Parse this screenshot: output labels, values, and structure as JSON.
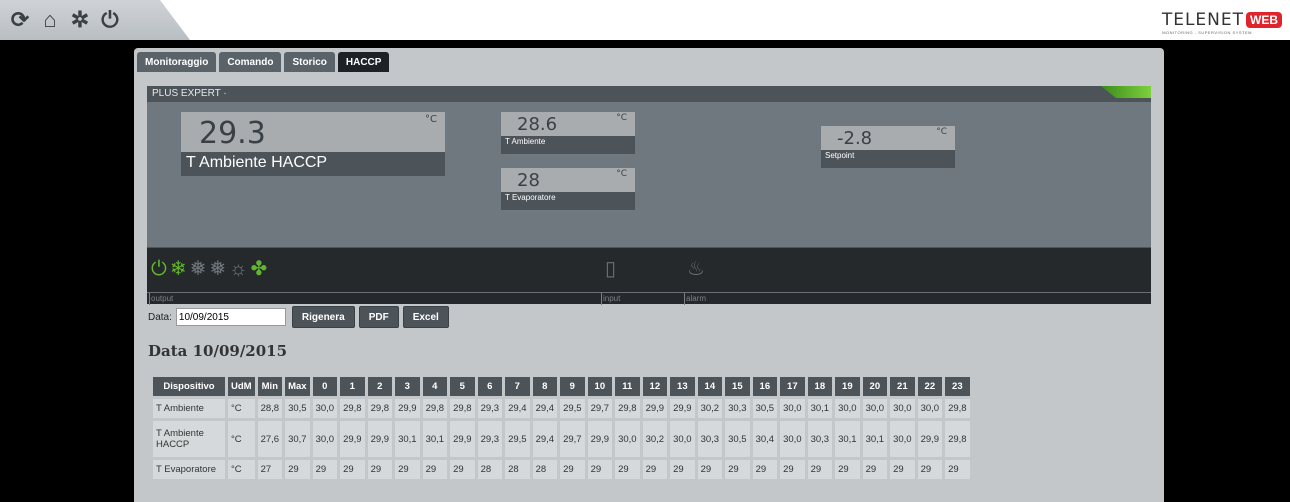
{
  "toolbar": {
    "icons": [
      "refresh-icon",
      "home-icon",
      "gear-icon",
      "power-icon"
    ],
    "refresh_glyph": "⟳",
    "home_glyph": "⌂",
    "gear_glyph": "✲",
    "power_glyph": "⏻"
  },
  "logo": {
    "text": "TELENET",
    "web": "WEB",
    "sub": "MONITORING - SUPERVISION SYSTEM"
  },
  "tabs": [
    {
      "label": "Monitoraggio",
      "active": false
    },
    {
      "label": "Comando",
      "active": false
    },
    {
      "label": "Storico",
      "active": false
    },
    {
      "label": "HACCP",
      "active": true
    }
  ],
  "device": {
    "name": "PLUS EXPERT ·",
    "main": {
      "value": "29.3",
      "unit": "°C",
      "label": "T Ambiente HACCP"
    },
    "t_ambiente": {
      "value": "28.6",
      "unit": "°C",
      "label": "T Ambiente"
    },
    "t_evaporatore": {
      "value": "28",
      "unit": "°C",
      "label": "T Evaporatore"
    },
    "setpoint": {
      "value": "-2.8",
      "unit": "°C",
      "label": "Setpoint"
    },
    "io": {
      "output_label": "output",
      "input_label": "input",
      "alarm_label": "alarm",
      "power_glyph": "⏻",
      "snow_glyph": "❄",
      "defrost_glyph": "❅",
      "sun_glyph": "☼",
      "fan_glyph": "✤",
      "door_glyph": "▯",
      "alarm_glyph": "♨",
      "accent": "#62b52e"
    }
  },
  "form": {
    "date_label": "Data:",
    "date_value": "10/09/2015",
    "rigenera": "Rigenera",
    "pdf": "PDF",
    "excel": "Excel"
  },
  "report_title": "Data 10/09/2015",
  "table": {
    "headers": [
      "Dispositivo",
      "UdM",
      "Min",
      "Max",
      "0",
      "1",
      "2",
      "3",
      "4",
      "5",
      "6",
      "7",
      "8",
      "9",
      "10",
      "11",
      "12",
      "13",
      "14",
      "15",
      "16",
      "17",
      "18",
      "19",
      "20",
      "21",
      "22",
      "23"
    ],
    "rows": [
      [
        "T Ambiente",
        "°C",
        "28,8",
        "30,5",
        "30,0",
        "29,8",
        "29,8",
        "29,9",
        "29,8",
        "29,8",
        "29,3",
        "29,4",
        "29,4",
        "29,5",
        "29,7",
        "29,8",
        "29,9",
        "29,9",
        "30,2",
        "30,3",
        "30,5",
        "30,0",
        "30,1",
        "30,0",
        "30,0",
        "30,0",
        "30,0",
        "29,8"
      ],
      [
        "T Ambiente HACCP",
        "°C",
        "27,6",
        "30,7",
        "30,0",
        "29,9",
        "29,9",
        "30,1",
        "30,1",
        "29,9",
        "29,3",
        "29,5",
        "29,4",
        "29,7",
        "29,9",
        "30,0",
        "30,2",
        "30,0",
        "30,3",
        "30,5",
        "30,4",
        "30,0",
        "30,3",
        "30,1",
        "30,1",
        "30,0",
        "29,9",
        "29,8"
      ],
      [
        "T Evaporatore",
        "°C",
        "27",
        "29",
        "29",
        "29",
        "29",
        "29",
        "29",
        "29",
        "28",
        "28",
        "28",
        "29",
        "29",
        "29",
        "29",
        "29",
        "29",
        "29",
        "29",
        "29",
        "29",
        "29",
        "29",
        "29",
        "29",
        "29"
      ]
    ]
  }
}
